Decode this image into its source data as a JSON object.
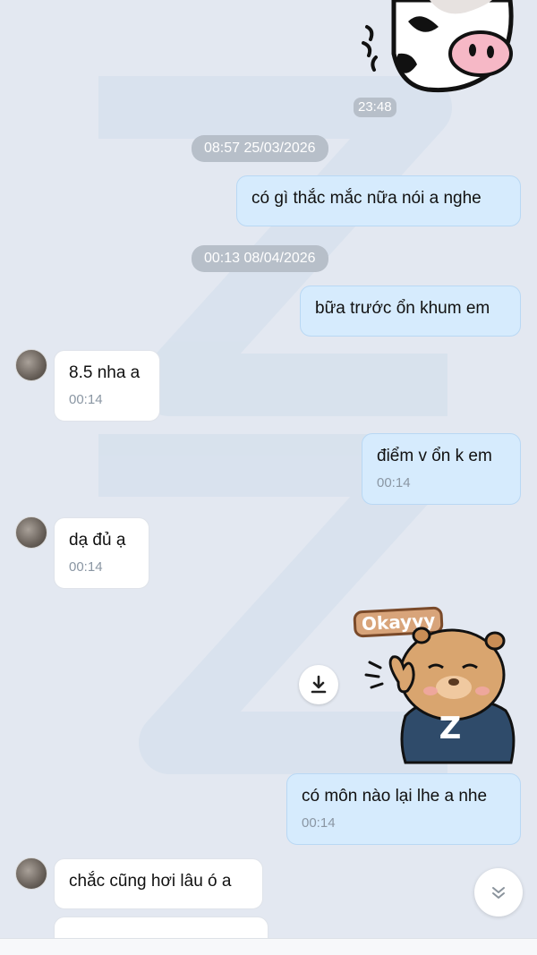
{
  "chat": {
    "sticker_time": "23:48",
    "date_separators": [
      "08:57 25/03/2026",
      "00:13 08/04/2026"
    ],
    "messages": [
      {
        "dir": "out",
        "text": "có gì thắc mắc nữa nói a nghe",
        "time": ""
      },
      {
        "dir": "out",
        "text": "bữa trước ổn khum em",
        "time": ""
      },
      {
        "dir": "in",
        "text": "8.5 nha a",
        "time": "00:14"
      },
      {
        "dir": "out",
        "text": "điểm v ổn k em",
        "time": "00:14"
      },
      {
        "dir": "in",
        "text": "dạ đủ ạ",
        "time": "00:14"
      },
      {
        "dir": "out",
        "text": "có môn nào lại lhe a nhe",
        "time": "00:14"
      },
      {
        "dir": "in",
        "text": "chắc cũng hơi lâu ó a",
        "time": ""
      }
    ],
    "sticker_okay": {
      "caption": "Okayyy",
      "shirt_letter": "Z"
    },
    "icons": {
      "download": "download-icon",
      "scroll_down": "double-chevron-down-icon",
      "avatar": "avatar"
    }
  }
}
